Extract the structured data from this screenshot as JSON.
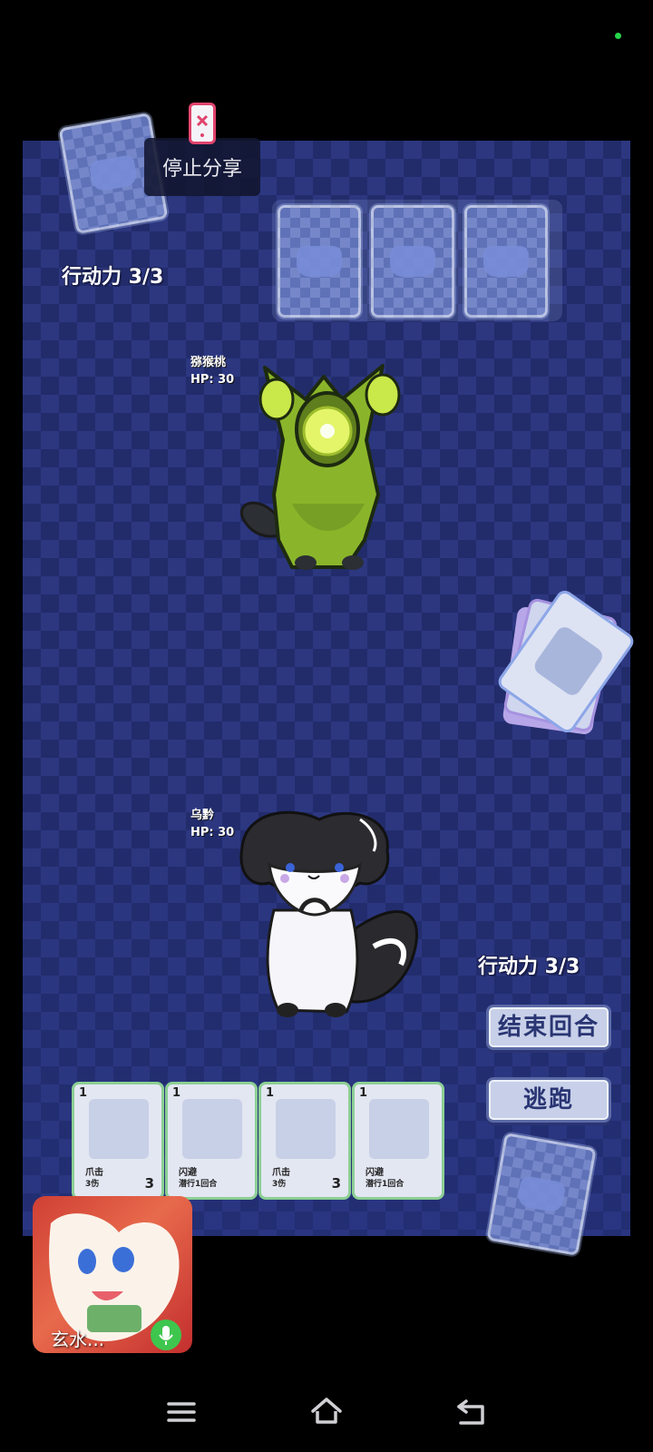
{
  "share_overlay": {
    "stop_sharing": "停止分享"
  },
  "enemy": {
    "name": "猕猴桃",
    "hp": "HP: 30",
    "action_points": "行动力 3/3"
  },
  "player": {
    "name": "乌黔",
    "hp": "HP: 30",
    "action_points": "行动力 3/3"
  },
  "buttons": {
    "end_turn": "结束回合",
    "flee": "逃跑"
  },
  "hand": [
    {
      "cost": "1",
      "name": "爪击",
      "desc": "3伤",
      "value": "3"
    },
    {
      "cost": "1",
      "name": "闪避",
      "desc": "潜行1回合",
      "value": ""
    },
    {
      "cost": "1",
      "name": "爪击",
      "desc": "3伤",
      "value": "3"
    },
    {
      "cost": "1",
      "name": "闪避",
      "desc": "潜行1回合",
      "value": ""
    }
  ],
  "video_call": {
    "caller_name": "玄水..."
  },
  "colors": {
    "board": "#222c6b",
    "card_border_playable": "#8ccf94",
    "button_text": "#2a3573"
  }
}
